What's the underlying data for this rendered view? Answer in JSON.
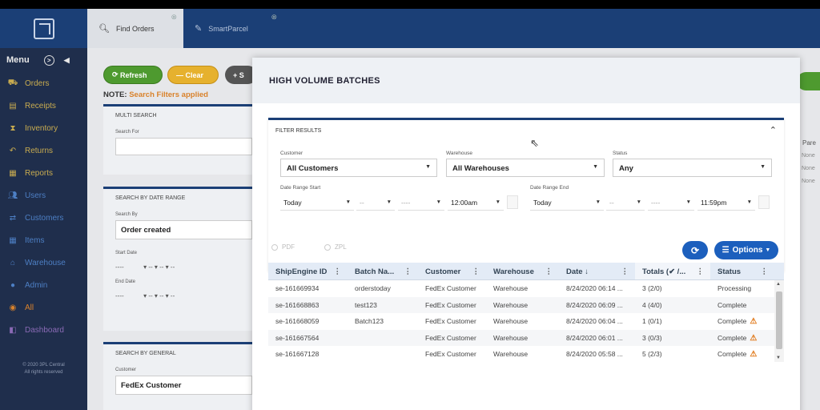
{
  "tabs": [
    {
      "label": "Find Orders",
      "icon": "search-icon",
      "close": "⊗"
    },
    {
      "label": "SmartParcel",
      "icon": "edit-icon",
      "close": "⊗"
    }
  ],
  "sidebar": {
    "menu_label": "Menu",
    "items": [
      {
        "label": "Orders",
        "icon": "truck-icon"
      },
      {
        "label": "Receipts",
        "icon": "receipt-icon"
      },
      {
        "label": "Inventory",
        "icon": "hourglass-icon"
      },
      {
        "label": "Returns",
        "icon": "return-icon"
      },
      {
        "label": "Reports",
        "icon": "chart-icon"
      },
      {
        "label": "Users",
        "icon": "users-icon"
      },
      {
        "label": "Customers",
        "icon": "handshake-icon"
      },
      {
        "label": "Items",
        "icon": "grid-icon"
      },
      {
        "label": "Warehouse",
        "icon": "warehouse-icon"
      },
      {
        "label": "Admin",
        "icon": "admin-icon"
      },
      {
        "label": "All",
        "icon": "circle-icon"
      },
      {
        "label": "Dashboard",
        "icon": "dashboard-icon"
      }
    ],
    "copyright_line1": "© 2020 3PL Central",
    "copyright_line2": "All rights reserved"
  },
  "background": {
    "refresh_label": "Refresh",
    "clear_label": "Clear",
    "add_label": "+ S",
    "note_label": "NOTE:",
    "note_text": "Search Filters applied",
    "multi_search_title": "MULTI SEARCH",
    "search_for_label": "Search For",
    "date_range_title": "SEARCH BY DATE RANGE",
    "search_by_label": "Search By",
    "search_by_value": "Order created",
    "start_date_label": "Start Date",
    "end_date_label": "End Date",
    "date_placeholder": "----",
    "general_title": "SEARCH BY GENERAL",
    "customer_label": "Customer",
    "customer_value": "FedEx Customer",
    "right_header": "Pare",
    "right_rows": [
      "None",
      "None",
      "None"
    ]
  },
  "modal": {
    "title": "HIGH VOLUME BATCHES",
    "filter_title": "FILTER RESULTS",
    "customer_label": "Customer",
    "customer_value": "All Customers",
    "warehouse_label": "Warehouse",
    "warehouse_value": "All Warehouses",
    "status_label": "Status",
    "status_value": "Any",
    "date_start_label": "Date Range Start",
    "date_end_label": "Date Range End",
    "start_day": "Today",
    "start_time": "12:00am",
    "end_day": "Today",
    "end_time": "11:59pm",
    "dash": "--",
    "dashes": "----",
    "radio_pdf": "PDF",
    "radio_zpl": "ZPL",
    "options_label": "Options"
  },
  "table": {
    "headers": [
      "ShipEngine ID",
      "Batch Na...",
      "Customer",
      "Warehouse",
      "Date",
      "Totals (",
      "Status"
    ],
    "date_sort": "↓",
    "totals_suffix": "✔ /...",
    "rows": [
      {
        "id": "se-161669934",
        "batch": "orderstoday",
        "customer": "FedEx Customer",
        "warehouse": "Warehouse",
        "date": "8/24/2020 06:14 ...",
        "totals": "3 (2/0)",
        "status": "Processing",
        "warn": false
      },
      {
        "id": "se-161668863",
        "batch": "test123",
        "customer": "FedEx Customer",
        "warehouse": "Warehouse",
        "date": "8/24/2020 06:09 ...",
        "totals": "4 (4/0)",
        "status": "Complete",
        "warn": false
      },
      {
        "id": "se-161668059",
        "batch": "Batch123",
        "customer": "FedEx Customer",
        "warehouse": "Warehouse",
        "date": "8/24/2020 06:04 ...",
        "totals": "1 (0/1)",
        "status": "Complete",
        "warn": true
      },
      {
        "id": "se-161667564",
        "batch": "",
        "customer": "FedEx Customer",
        "warehouse": "Warehouse",
        "date": "8/24/2020 06:01 ...",
        "totals": "3 (0/3)",
        "status": "Complete",
        "warn": true
      },
      {
        "id": "se-161667128",
        "batch": "",
        "customer": "FedEx Customer",
        "warehouse": "Warehouse",
        "date": "8/24/2020 05:58 ...",
        "totals": "5 (2/3)",
        "status": "Complete",
        "warn": true
      }
    ]
  },
  "colors": {
    "navy": "#1b3f76",
    "sidebar": "#1f2e4c",
    "accent_blue": "#1c5fbd",
    "warning": "#e0791a",
    "green": "#4e9a2f",
    "yellow": "#e6b12e"
  }
}
